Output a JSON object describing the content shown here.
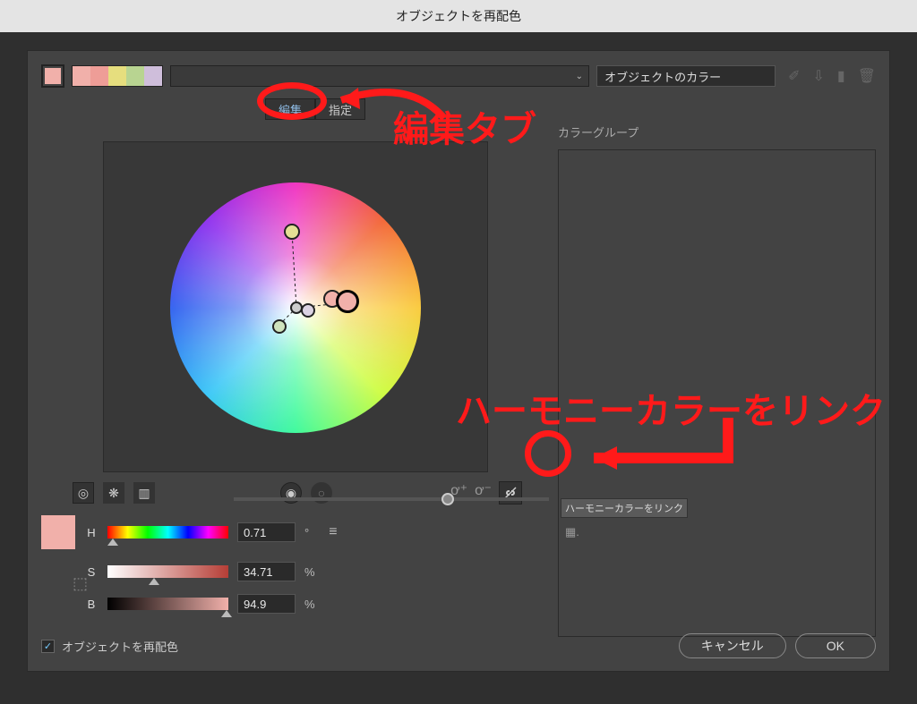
{
  "title": "オブジェクトを再配色",
  "current_swatch": "#f1b0aa",
  "palette": [
    "#f1b0aa",
    "#ee9d97",
    "#e6de7e",
    "#b8d491",
    "#cfbedb"
  ],
  "preset_label": "オブジェクトのカラー",
  "tabs": {
    "edit": "編集",
    "assign": "指定"
  },
  "color_groups_label": "カラーグループ",
  "hsb": {
    "h": {
      "label": "H",
      "value": "0.71",
      "unit": "°"
    },
    "s": {
      "label": "S",
      "value": "34.71",
      "unit": "%"
    },
    "b": {
      "label": "B",
      "value": "94.9",
      "unit": "%"
    }
  },
  "checkbox_label": "オブジェクトを再配色",
  "buttons": {
    "cancel": "キャンセル",
    "ok": "OK"
  },
  "tooltip": "ハーモニーカラーをリンク",
  "annotations": {
    "tab": "編集タブ",
    "link": "ハーモニーカラーをリンク"
  }
}
